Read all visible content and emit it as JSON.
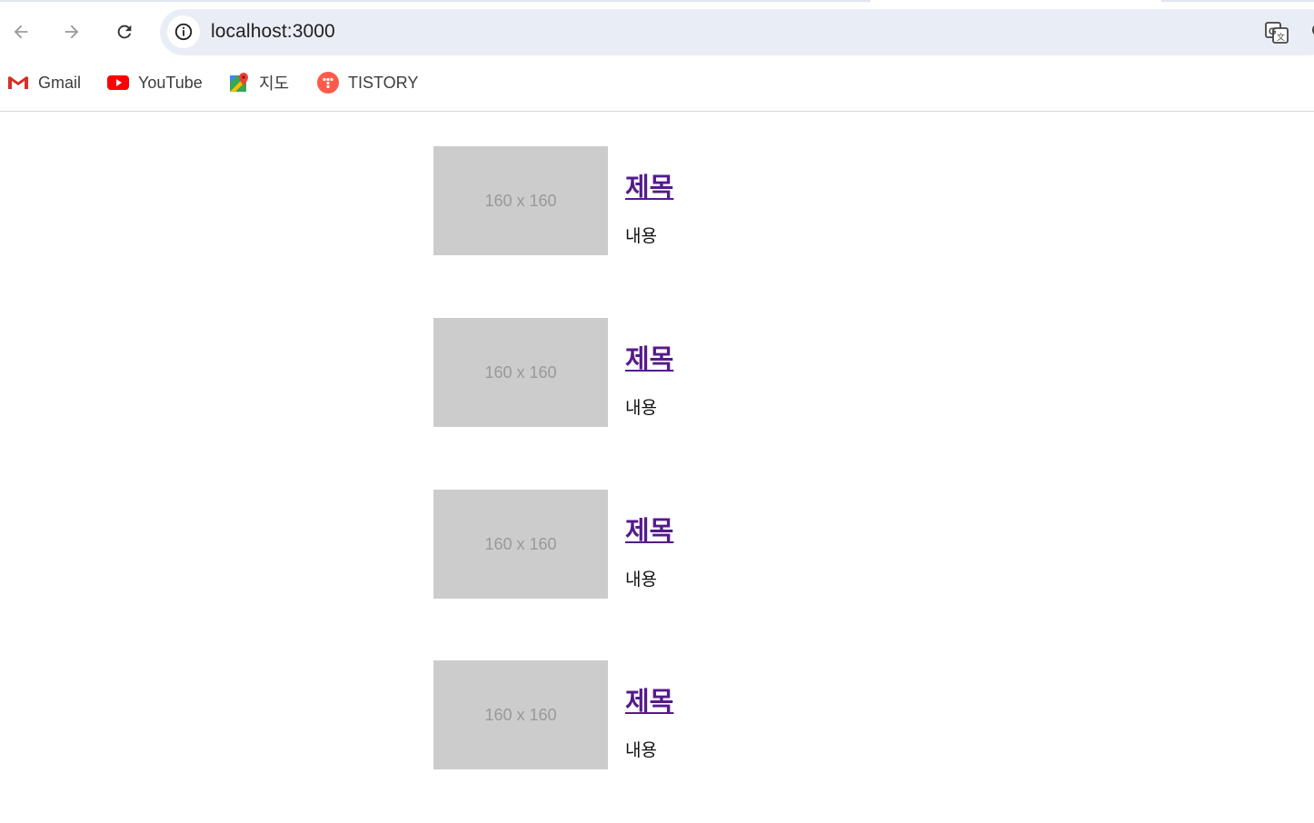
{
  "browser": {
    "url": "localhost:3000",
    "bookmarks": [
      {
        "label": "Gmail",
        "icon": "gmail-icon"
      },
      {
        "label": "YouTube",
        "icon": "youtube-icon"
      },
      {
        "label": "지도",
        "icon": "maps-icon"
      },
      {
        "label": "TISTORY",
        "icon": "tistory-icon"
      }
    ]
  },
  "posts": [
    {
      "thumb": "160 x 160",
      "title": "제목",
      "body": "내용"
    },
    {
      "thumb": "160 x 160",
      "title": "제목",
      "body": "내용"
    },
    {
      "thumb": "160 x 160",
      "title": "제목",
      "body": "내용"
    },
    {
      "thumb": "160 x 160",
      "title": "제목",
      "body": "내용"
    }
  ],
  "colors": {
    "visited_link": "#551a8b",
    "placeholder_bg": "#cccccc",
    "placeholder_text": "#999999",
    "omnibox_bg": "#e9eef6"
  }
}
